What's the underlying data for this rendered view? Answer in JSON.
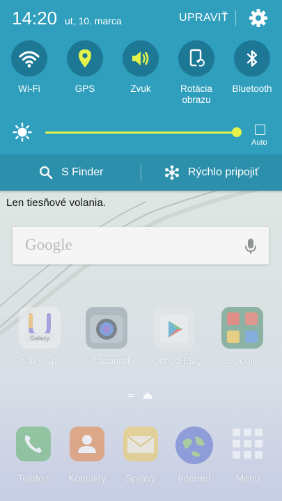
{
  "status": {
    "time": "14:20",
    "date": "ut, 10. marca",
    "edit_label": "UPRAVIŤ"
  },
  "toggles": [
    {
      "label": "Wi-Fi",
      "icon": "wifi-icon",
      "state": "on"
    },
    {
      "label": "GPS",
      "icon": "location-pin-icon",
      "state": "on"
    },
    {
      "label": "Zvuk",
      "icon": "speaker-icon",
      "state": "on"
    },
    {
      "label": "Rotácia\nobrazu",
      "icon": "screen-rotation-icon",
      "state": "off"
    },
    {
      "label": "Bluetooth",
      "icon": "bluetooth-icon",
      "state": "off"
    }
  ],
  "brightness": {
    "level": 1.0,
    "auto_label": "Auto",
    "auto_checked": false
  },
  "finder": {
    "search_label": "S Finder",
    "quick_connect_label": "Rýchlo pripojiť"
  },
  "home": {
    "emergency_text": "Len tiesňové volania.",
    "search_logo": "Google",
    "apps_row1": [
      {
        "label": "Galaxy Apps",
        "icon": "galaxy-apps-icon"
      },
      {
        "label": "Fotoaparát",
        "icon": "camera-icon"
      },
      {
        "label": "Obchod Play",
        "icon": "play-store-icon"
      },
      {
        "label": "Google",
        "icon": "google-folder-icon"
      }
    ],
    "dock": [
      {
        "label": "Telefón",
        "icon": "phone-icon"
      },
      {
        "label": "Kontakty",
        "icon": "contacts-icon"
      },
      {
        "label": "Správy",
        "icon": "messages-icon"
      },
      {
        "label": "Internet",
        "icon": "internet-globe-icon"
      },
      {
        "label": "Menu",
        "icon": "apps-grid-icon"
      }
    ]
  },
  "colors": {
    "panel": "#2f9fbd",
    "toggle_circle": "#1c7894",
    "active_accent": "#e3f34a",
    "finder_bar": "#2c8fac"
  }
}
